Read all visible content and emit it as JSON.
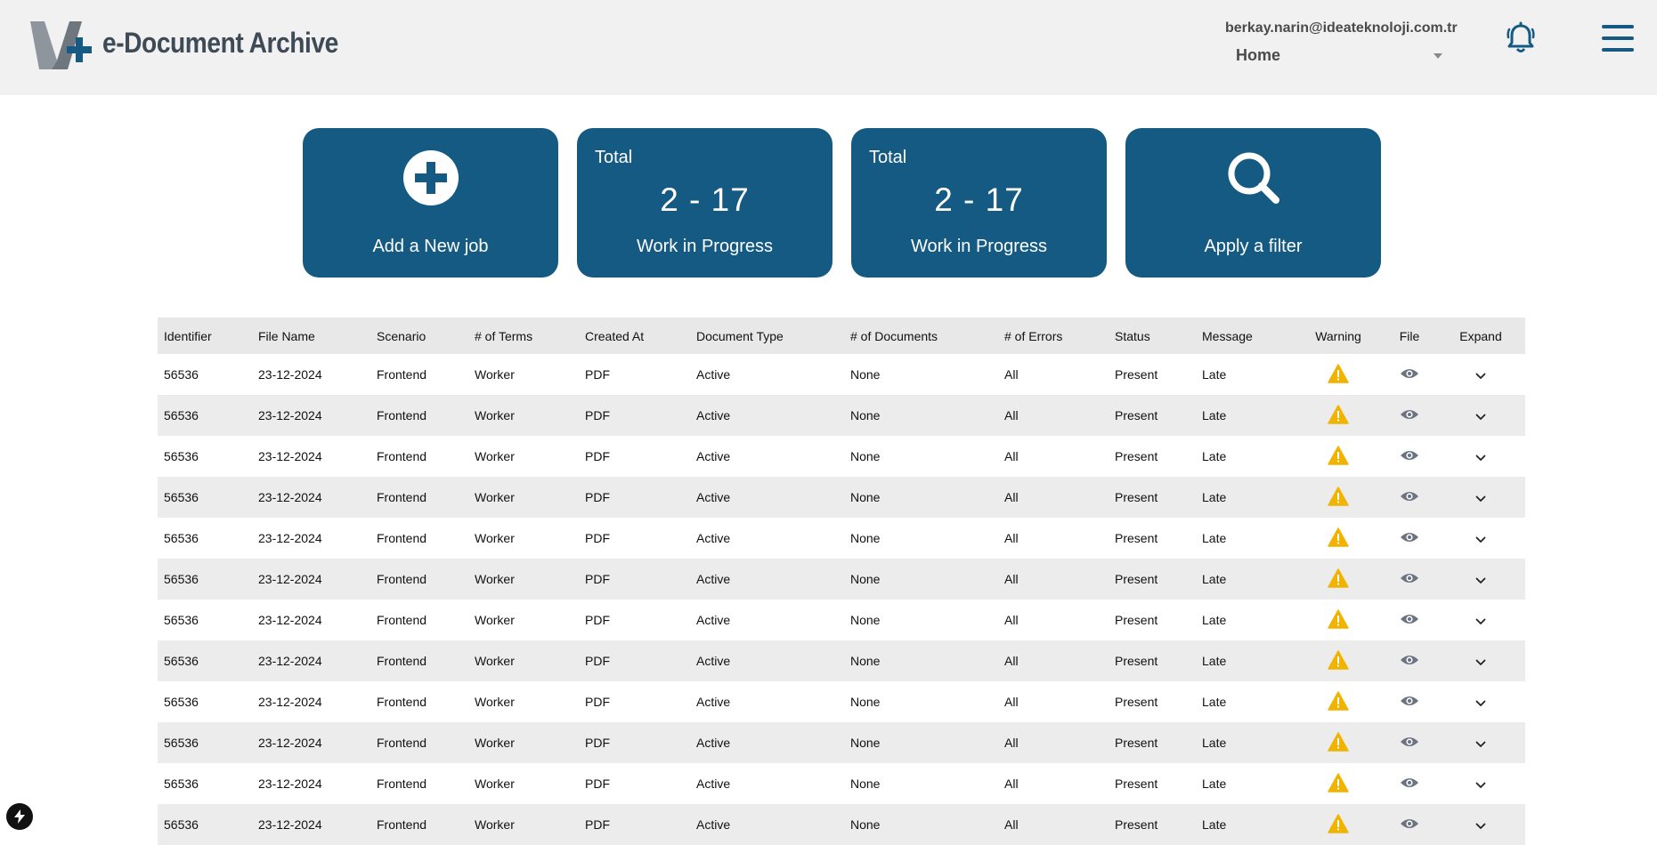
{
  "app": {
    "title": "e-Document Archive",
    "user_email": "berkay.narin@ideateknoloji.com.tr",
    "nav_selected": "Home",
    "accent_color": "#155a82",
    "header_bg": "#f1f1f1",
    "warning_color": "#f0b400"
  },
  "icons": {
    "notifications": "bell-icon",
    "menu": "hamburger-menu-icon",
    "add": "plus-circle-icon",
    "filter": "search-icon",
    "warning": "warning-triangle-icon",
    "file": "eye-icon",
    "expand": "chevron-down-icon",
    "dev": "lightning-bolt-icon"
  },
  "cards": {
    "add_job": {
      "label": "Add a New job"
    },
    "progress1": {
      "total_label": "Total",
      "value": "2 - 17",
      "label": "Work in Progress"
    },
    "progress2": {
      "total_label": "Total",
      "value": "2 - 17",
      "label": "Work in Progress"
    },
    "filter": {
      "label": "Apply a filter"
    }
  },
  "table": {
    "columns": [
      "Identifier",
      "File Name",
      "Scenario",
      "# of Terms",
      "Created At",
      "Document Type",
      "# of Documents",
      "# of Errors",
      "Status",
      "Message",
      "Warning",
      "File",
      "Expand"
    ],
    "rows": [
      [
        "56536",
        "23-12-2024",
        "Frontend",
        "Worker",
        "PDF",
        "Active",
        "None",
        "All",
        "Present",
        "Late"
      ],
      [
        "56536",
        "23-12-2024",
        "Frontend",
        "Worker",
        "PDF",
        "Active",
        "None",
        "All",
        "Present",
        "Late"
      ],
      [
        "56536",
        "23-12-2024",
        "Frontend",
        "Worker",
        "PDF",
        "Active",
        "None",
        "All",
        "Present",
        "Late"
      ],
      [
        "56536",
        "23-12-2024",
        "Frontend",
        "Worker",
        "PDF",
        "Active",
        "None",
        "All",
        "Present",
        "Late"
      ],
      [
        "56536",
        "23-12-2024",
        "Frontend",
        "Worker",
        "PDF",
        "Active",
        "None",
        "All",
        "Present",
        "Late"
      ],
      [
        "56536",
        "23-12-2024",
        "Frontend",
        "Worker",
        "PDF",
        "Active",
        "None",
        "All",
        "Present",
        "Late"
      ],
      [
        "56536",
        "23-12-2024",
        "Frontend",
        "Worker",
        "PDF",
        "Active",
        "None",
        "All",
        "Present",
        "Late"
      ],
      [
        "56536",
        "23-12-2024",
        "Frontend",
        "Worker",
        "PDF",
        "Active",
        "None",
        "All",
        "Present",
        "Late"
      ],
      [
        "56536",
        "23-12-2024",
        "Frontend",
        "Worker",
        "PDF",
        "Active",
        "None",
        "All",
        "Present",
        "Late"
      ],
      [
        "56536",
        "23-12-2024",
        "Frontend",
        "Worker",
        "PDF",
        "Active",
        "None",
        "All",
        "Present",
        "Late"
      ],
      [
        "56536",
        "23-12-2024",
        "Frontend",
        "Worker",
        "PDF",
        "Active",
        "None",
        "All",
        "Present",
        "Late"
      ],
      [
        "56536",
        "23-12-2024",
        "Frontend",
        "Worker",
        "PDF",
        "Active",
        "None",
        "All",
        "Present",
        "Late"
      ]
    ]
  }
}
